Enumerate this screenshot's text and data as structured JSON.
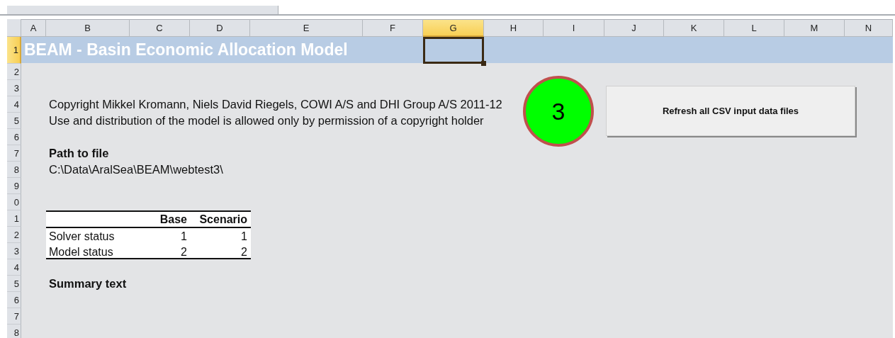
{
  "columns": [
    {
      "label": "A",
      "selected": false
    },
    {
      "label": "B",
      "selected": false
    },
    {
      "label": "C",
      "selected": false
    },
    {
      "label": "D",
      "selected": false
    },
    {
      "label": "E",
      "selected": false
    },
    {
      "label": "F",
      "selected": false
    },
    {
      "label": "G",
      "selected": true
    },
    {
      "label": "H",
      "selected": false
    },
    {
      "label": "I",
      "selected": false
    },
    {
      "label": "J",
      "selected": false
    },
    {
      "label": "K",
      "selected": false
    },
    {
      "label": "L",
      "selected": false
    },
    {
      "label": "M",
      "selected": false
    },
    {
      "label": "N",
      "selected": false
    }
  ],
  "rows": [
    {
      "label": "1",
      "selected": true
    },
    {
      "label": "2",
      "selected": false
    },
    {
      "label": "3",
      "selected": false
    },
    {
      "label": "4",
      "selected": false
    },
    {
      "label": "5",
      "selected": false
    },
    {
      "label": "6",
      "selected": false
    },
    {
      "label": "7",
      "selected": false
    },
    {
      "label": "8",
      "selected": false
    },
    {
      "label": "9",
      "selected": false
    },
    {
      "label": "0",
      "selected": false
    },
    {
      "label": "1",
      "selected": false
    },
    {
      "label": "2",
      "selected": false
    },
    {
      "label": "3",
      "selected": false
    },
    {
      "label": "4",
      "selected": false
    },
    {
      "label": "5",
      "selected": false
    },
    {
      "label": "6",
      "selected": false
    },
    {
      "label": "7",
      "selected": false
    },
    {
      "label": "8",
      "selected": false
    }
  ],
  "title": "BEAM - Basin Economic Allocation Model",
  "copyright_lines": [
    "Copyright Mikkel Kromann, Niels David Riegels, COWI A/S and DHI Group A/S 2011-12",
    "Use and distribution of the model is allowed only by permission of a copyright holder"
  ],
  "path_label": "Path to file",
  "path_value": "C:\\Data\\AralSea\\BEAM\\webtest3\\",
  "status_table": {
    "columns": [
      "Base",
      "Scenario"
    ],
    "rows": [
      {
        "label": "Solver status",
        "values": [
          "1",
          "1"
        ]
      },
      {
        "label": "Model status",
        "values": [
          "2",
          "2"
        ]
      }
    ]
  },
  "summary_label": "Summary text",
  "status_badge": "3",
  "refresh_button": "Refresh all CSV input data files"
}
